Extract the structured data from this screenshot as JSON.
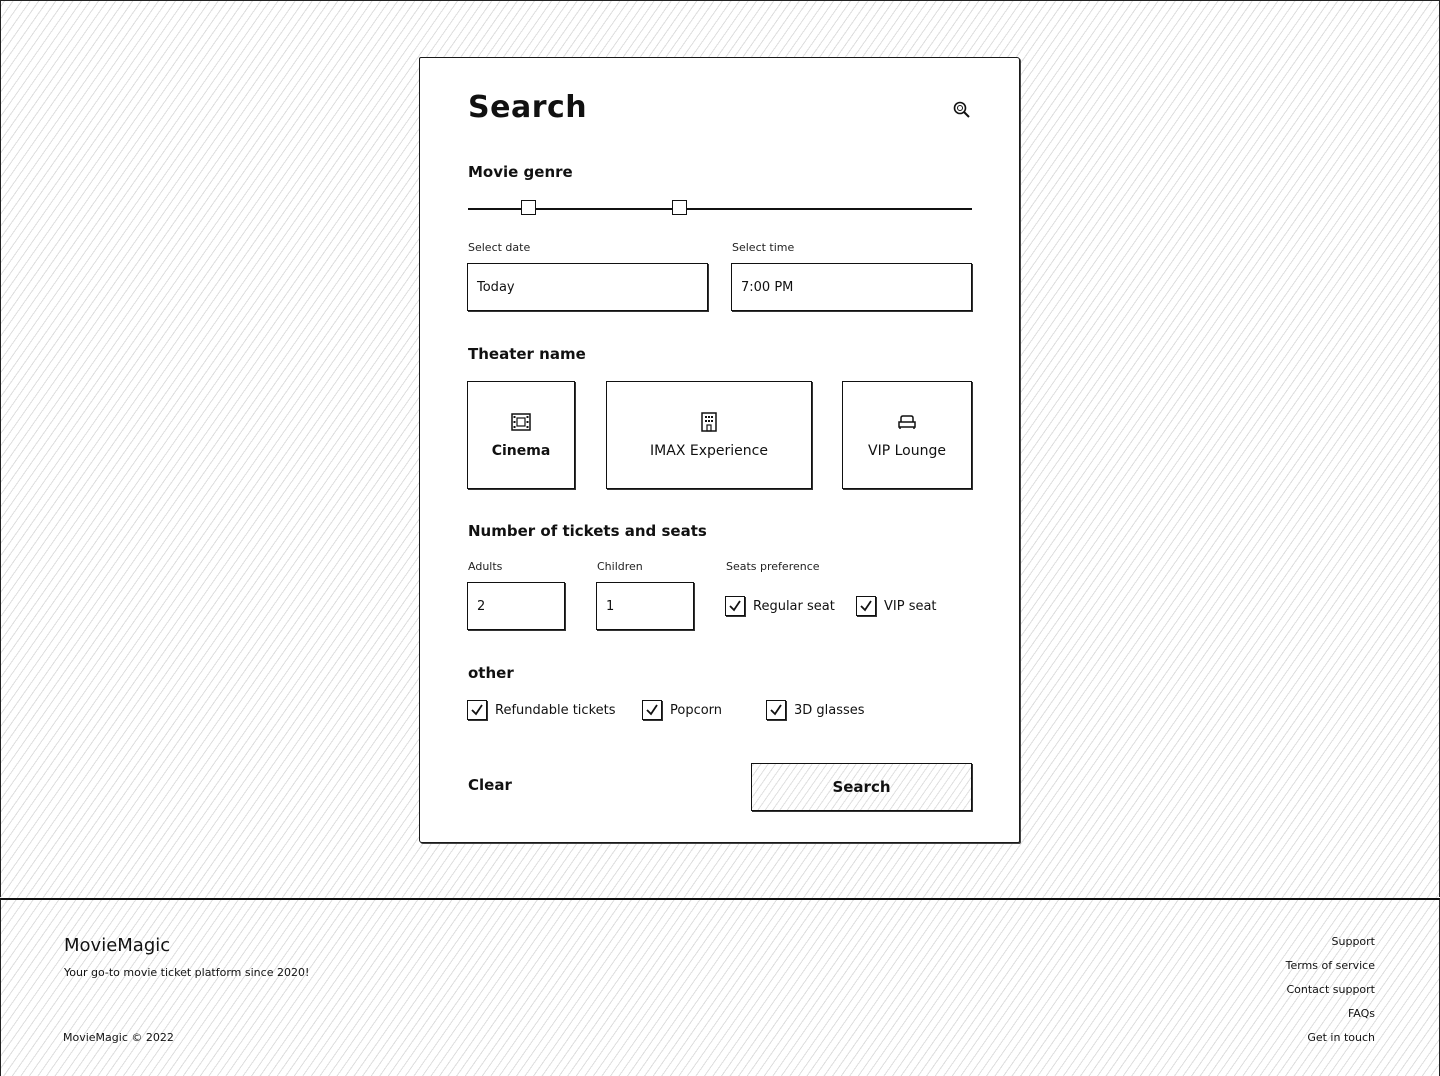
{
  "search_panel": {
    "title": "Search",
    "genre_label": "Movie genre",
    "genre_range": [
      0.12,
      0.42
    ],
    "date_label": "Select date",
    "date_value": "Today",
    "time_label": "Select time",
    "time_value": "7:00 PM",
    "theater_label": "Theater name",
    "theaters": [
      {
        "label": "Cinema",
        "icon": "film-icon",
        "selected": true
      },
      {
        "label": "IMAX Experience",
        "icon": "building-icon",
        "selected": false
      },
      {
        "label": "VIP Lounge",
        "icon": "sofa-icon",
        "selected": false
      }
    ],
    "tickets_label": "Number of tickets and seats",
    "adults_label": "Adults",
    "adults_value": "2",
    "children_label": "Children",
    "children_value": "1",
    "seats_label": "Seats preference",
    "seat_options": [
      {
        "label": "Regular seat",
        "checked": true
      },
      {
        "label": "VIP seat",
        "checked": true
      }
    ],
    "other_label": "other",
    "other_options": [
      {
        "label": "Refundable tickets",
        "checked": true
      },
      {
        "label": "Popcorn",
        "checked": true
      },
      {
        "label": "3D glasses",
        "checked": true
      }
    ],
    "clear_label": "Clear",
    "search_button_label": "Search"
  },
  "footer": {
    "brand": "MovieMagic",
    "tagline": "Your go-to movie ticket platform since 2020!",
    "copyright": "MovieMagic © 2022",
    "links": [
      "Support",
      "Terms of service",
      "Contact support",
      "FAQs",
      "Get in touch"
    ]
  }
}
